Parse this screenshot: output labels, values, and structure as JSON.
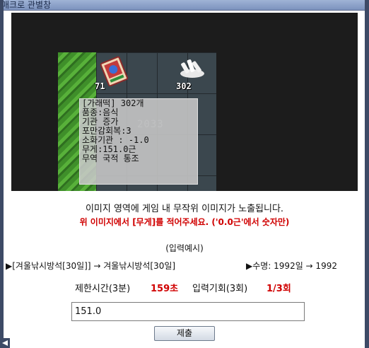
{
  "window": {
    "title": "매크로 관별창"
  },
  "game": {
    "slot1_number": "71",
    "slot2_number": "302",
    "watermark": "2033",
    "tooltip_lines": [
      "[가래떡] 302개",
      "품종:음식",
      "기관 증가",
      "포만감회복:3",
      "소화기관 : -1.0",
      "무게:151.0근",
      "무역 국적 통조"
    ]
  },
  "instructions": {
    "description": "이미지 영역에 게임 내 무작위 이미지가 노출됩니다.",
    "warning": "위 이미지에서 [무게]를 적어주세요. ('0.0근'에서 숫자만)"
  },
  "example": {
    "title": "(입력예시)",
    "line1": "▶[겨울낚시방석[30일]] → 겨울낚시방석[30일]",
    "line2": "▶수명: 1992일 → 1992"
  },
  "limits": {
    "time_label": "제한시간(3분)",
    "time_value": "159초",
    "chance_label": "입력기회(3회)",
    "chance_value": "1/3회"
  },
  "form": {
    "answer_value": "151.0",
    "submit_label": "제출"
  },
  "colors": {
    "warning": "#d00000",
    "background": "#ffffff",
    "game_bg": "#1c1c1c"
  }
}
